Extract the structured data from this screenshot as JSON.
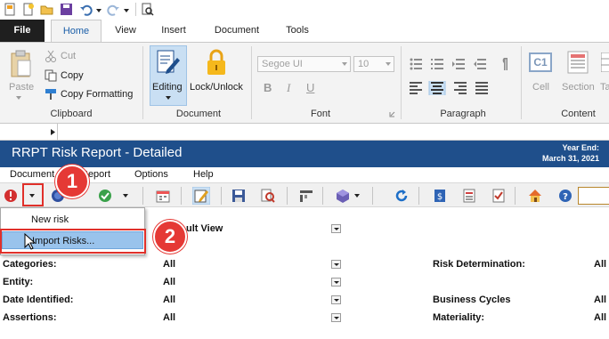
{
  "ribbon": {
    "tabs": [
      "File",
      "Home",
      "View",
      "Insert",
      "Document",
      "Tools"
    ],
    "clipboard": {
      "paste": "Paste",
      "cut": "Cut",
      "copy": "Copy",
      "copy_formatting": "Copy Formatting",
      "group": "Clipboard"
    },
    "document": {
      "editing": "Editing",
      "lock_unlock": "Lock/Unlock",
      "group": "Document"
    },
    "font": {
      "family": "Segoe UI",
      "size": "10",
      "bold": "B",
      "italic": "I",
      "underline": "U",
      "group": "Font"
    },
    "paragraph": {
      "group": "Paragraph"
    },
    "content": {
      "cell_icon": "C1",
      "cell": "Cell",
      "section": "Section",
      "table": "Ta",
      "group": "Content"
    }
  },
  "report": {
    "title": "RRPT Risk Report - Detailed",
    "year_end_label": "Year End:",
    "year_end_date": "March 31, 2021"
  },
  "menu": {
    "items": [
      "Document",
      "Report",
      "Options",
      "Help"
    ]
  },
  "dropdown": {
    "items": [
      "New risk",
      "Import Risks..."
    ]
  },
  "annotations": {
    "step1": "1",
    "step2": "2"
  },
  "view_label": "ult View",
  "fields": [
    {
      "label": "Categories:",
      "value": "All",
      "right_label": "Risk Determination:",
      "right_value": "All"
    },
    {
      "label": "Entity:",
      "value": "All",
      "right_label": "",
      "right_value": ""
    },
    {
      "label": "Date Identified:",
      "value": "All",
      "right_label": "Business Cycles",
      "right_value": "All"
    },
    {
      "label": "Assertions:",
      "value": "All",
      "right_label": "Materiality:",
      "right_value": "All"
    }
  ],
  "colors": {
    "header_blue": "#1f4f8b",
    "highlight": "#99c3ec",
    "annotation_red": "#e53935"
  }
}
